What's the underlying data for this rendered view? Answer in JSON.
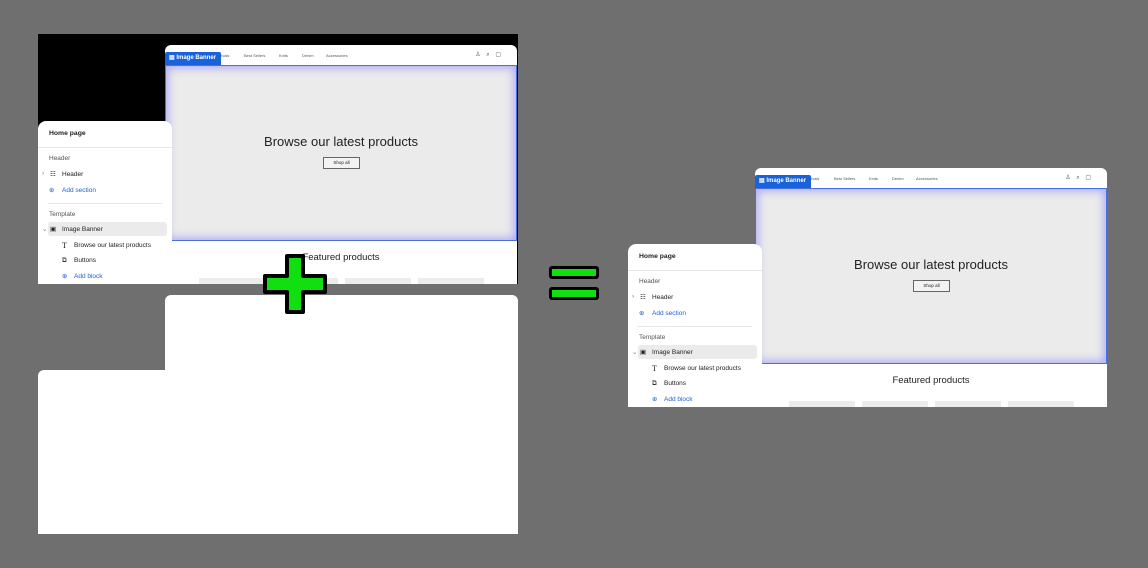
{
  "sidebar": {
    "title": "Home page",
    "header_group": "Header",
    "header_item": "Header",
    "add_section": "Add section",
    "template_group": "Template",
    "image_banner": "Image Banner",
    "block_text": "Browse our latest products",
    "block_buttons": "Buttons",
    "add_block": "Add block"
  },
  "store": {
    "nav": [
      "rivals",
      "Best Sellers",
      "Knits",
      "Denim",
      "Accessories"
    ],
    "icons": "♙ ⌕ ▢",
    "tag": "Image Banner",
    "banner_title": "Browse our latest products",
    "shop_all": "Shop all",
    "featured": "Featured products"
  },
  "colors": {
    "accent": "#1863dc",
    "plus": "#10e010"
  }
}
